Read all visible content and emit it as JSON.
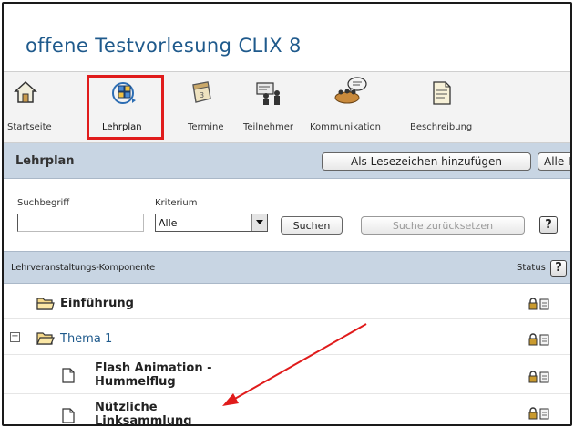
{
  "app": {
    "title": "offene Testvorlesung CLIX 8"
  },
  "nav": {
    "items": [
      {
        "label": "Startseite",
        "icon": "house-icon"
      },
      {
        "label": "Lehrplan",
        "icon": "curriculum-icon",
        "selected": true
      },
      {
        "label": "Termine",
        "icon": "calendar-icon"
      },
      {
        "label": "Teilnehmer",
        "icon": "participants-icon"
      },
      {
        "label": "Kommunikation",
        "icon": "communication-icon"
      },
      {
        "label": "Beschreibung",
        "icon": "description-icon"
      }
    ]
  },
  "header": {
    "title": "Lehrplan",
    "bookmark_label": "Als Lesezeichen hinzufügen",
    "all_label": "Alle I"
  },
  "search": {
    "term_label": "Suchbegriff",
    "term_value": "",
    "criterion_label": "Kriterium",
    "criterion_value": "Alle",
    "search_button": "Suchen",
    "reset_button": "Suche zurücksetzen",
    "help": "?"
  },
  "table": {
    "col_component": "Lehrveranstaltungs-Komponente",
    "col_status": "Status",
    "help": "?",
    "rows": [
      {
        "label": "Einführung",
        "type": "folder",
        "bold": true
      },
      {
        "label": "Thema 1",
        "type": "folder",
        "expanded": true,
        "link": true,
        "expand_symbol": "−"
      },
      {
        "label_line1": "Flash Animation -",
        "label_line2": "Hummelflug",
        "type": "document",
        "bold": true
      },
      {
        "label_line1": "Nützliche",
        "label_line2": "Linksammlung",
        "type": "document",
        "bold": true
      }
    ]
  },
  "colors": {
    "title": "#1f5a8c",
    "header_bar": "#c8d5e3",
    "highlight_box": "#e01b1b",
    "annotation_arrow": "#e01b1b"
  }
}
